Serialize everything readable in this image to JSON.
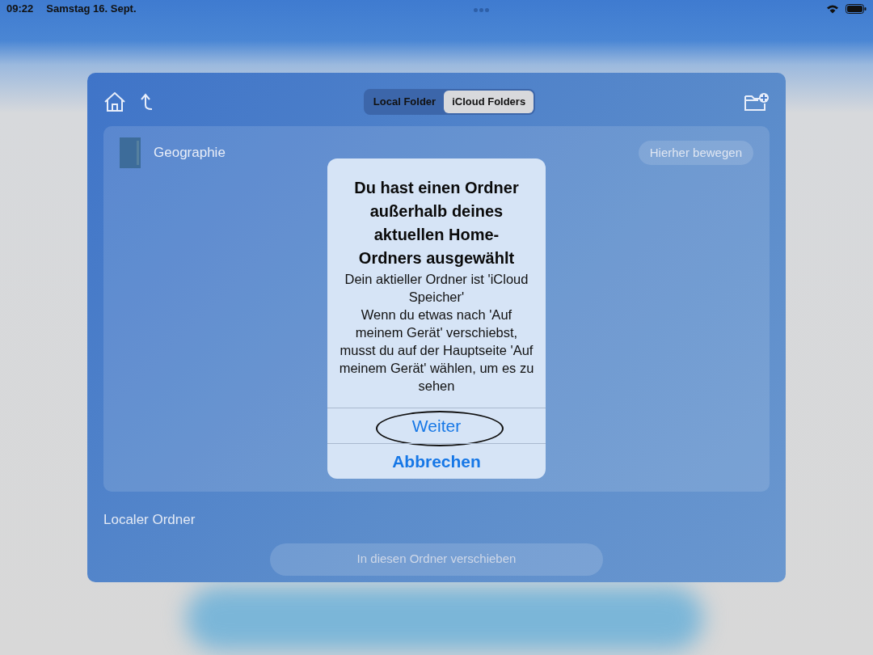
{
  "status_bar": {
    "time": "09:22",
    "date": "Samstag 16. Sept."
  },
  "toolbar": {
    "tabs": [
      {
        "label": "Local Folder",
        "selected": false
      },
      {
        "label": "iCloud Folders",
        "selected": true
      }
    ]
  },
  "folders": [
    {
      "name": "Geographie",
      "action": "Hierher bewegen"
    }
  ],
  "section_label": "Localer Ordner",
  "move_button": {
    "label": "In diesen Ordner verschieben",
    "disabled": true
  },
  "alert": {
    "title": "Du hast einen Ordner außerhalb deines aktuellen Home-Ordners ausgewählt",
    "message": [
      "Dein aktieller Ordner ist 'iCloud Speicher'",
      "Wenn du etwas nach 'Auf meinem Gerät' verschiebst, musst du auf der Hauptseite 'Auf meinem Gerät' wählen, um es zu sehen"
    ],
    "actions": [
      {
        "label": "Weiter",
        "kind": "default",
        "circled": true
      },
      {
        "label": "Abbrechen",
        "kind": "cancel",
        "circled": false
      }
    ]
  }
}
